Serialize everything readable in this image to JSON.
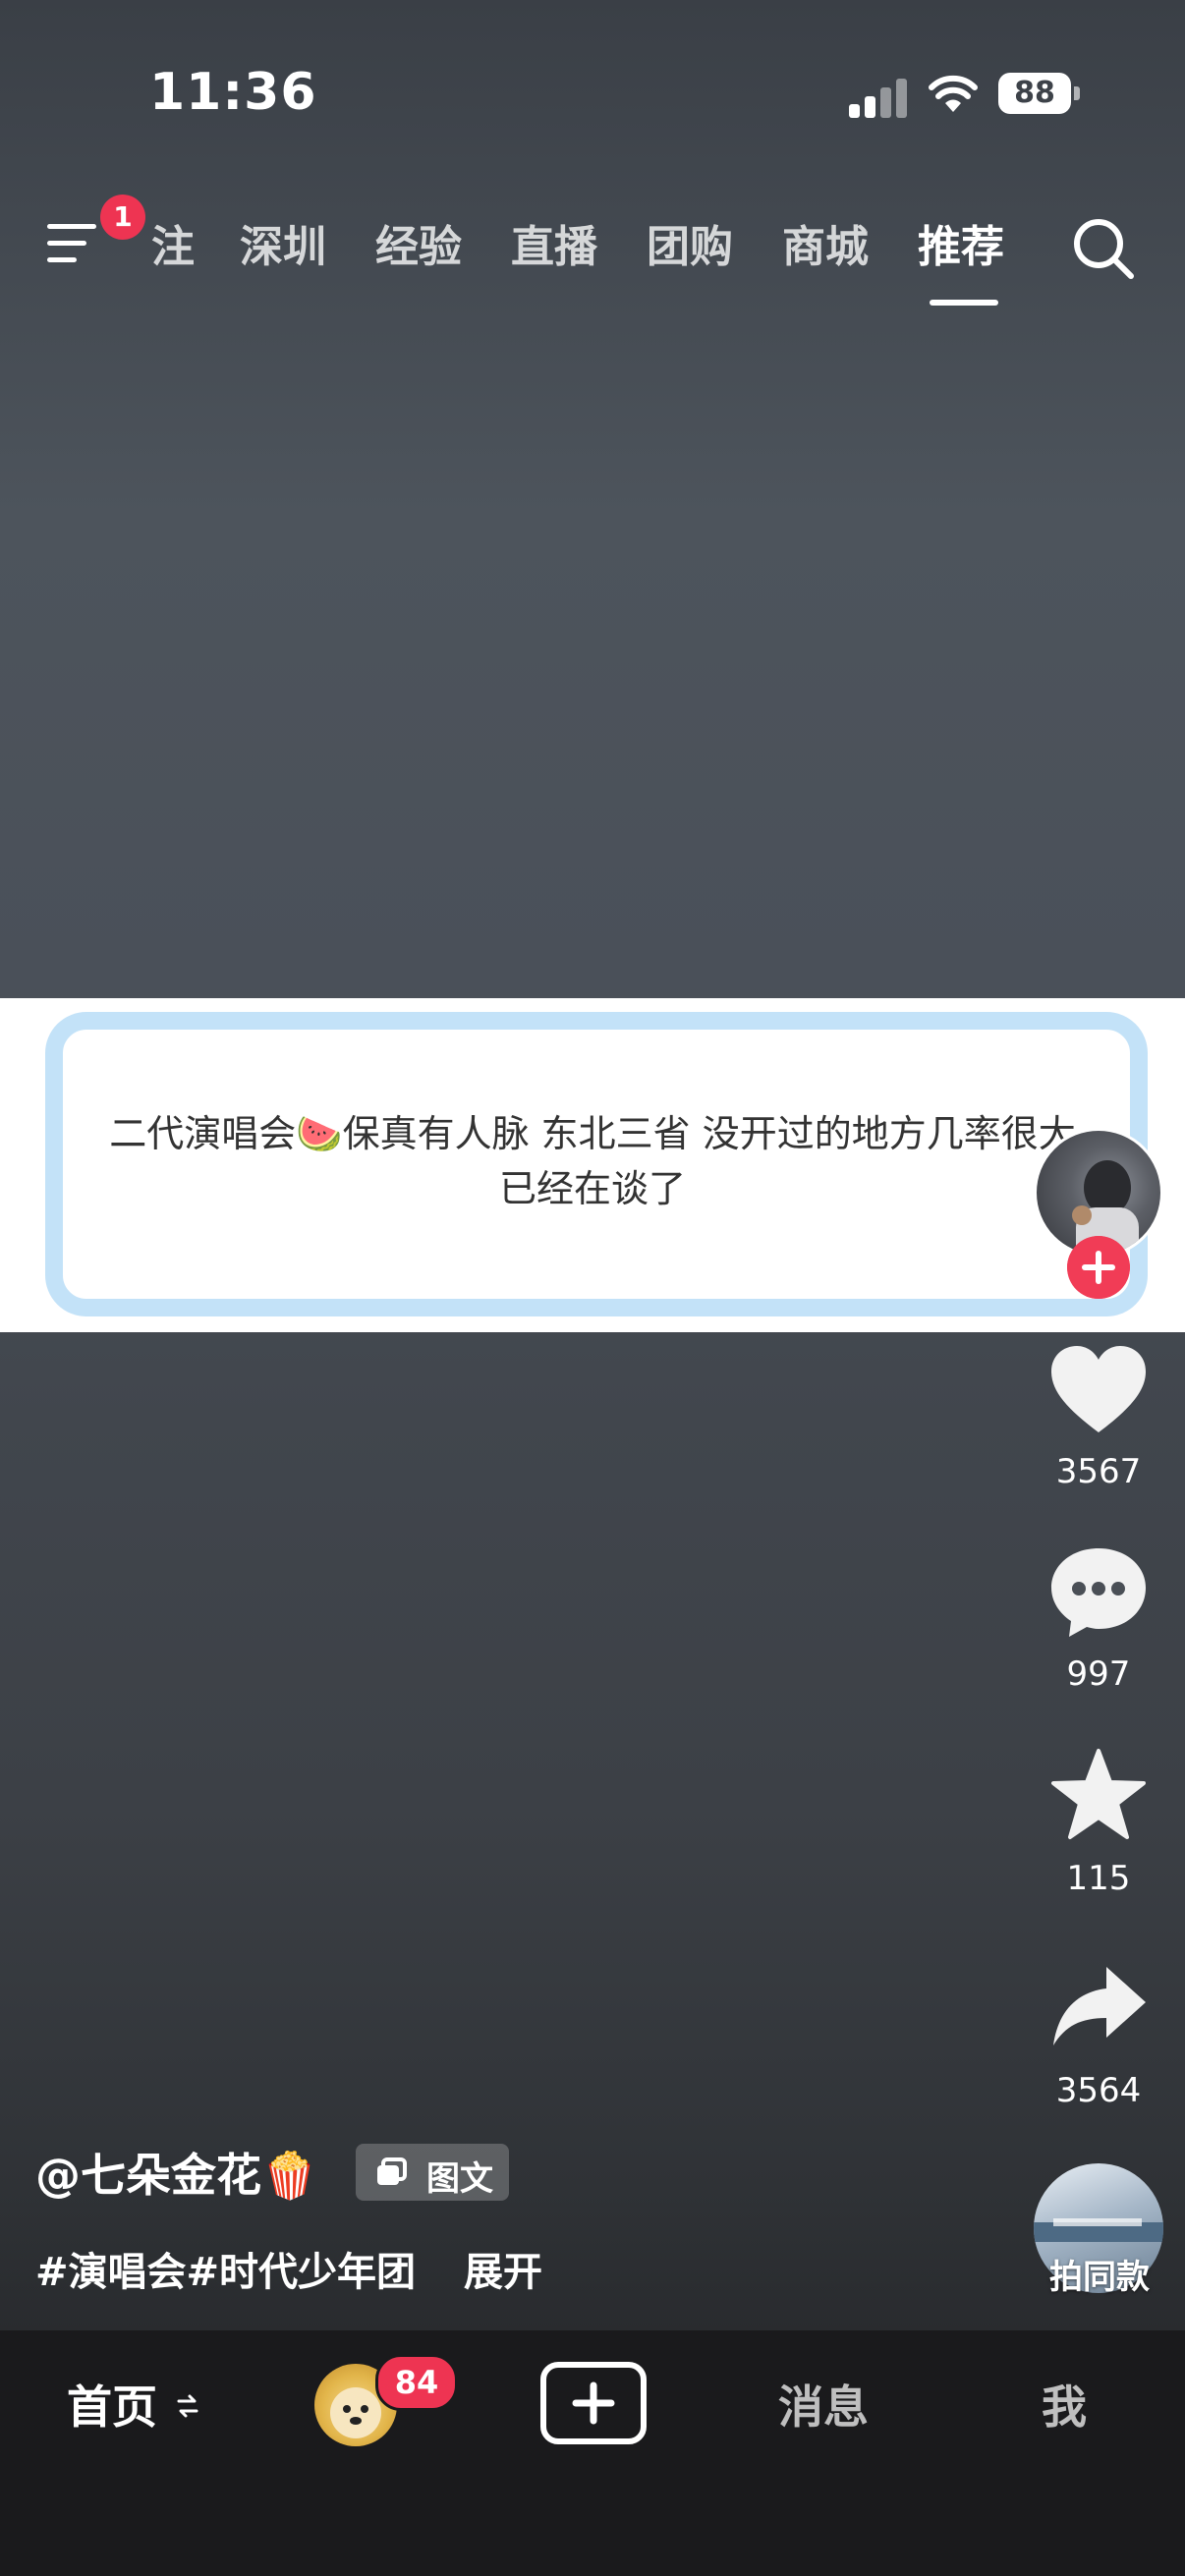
{
  "status_bar": {
    "time": "11:36",
    "battery": "88"
  },
  "top_nav": {
    "menu_badge": "1",
    "tabs": [
      {
        "label": "注"
      },
      {
        "label": "深圳"
      },
      {
        "label": "经验"
      },
      {
        "label": "直播"
      },
      {
        "label": "团购"
      },
      {
        "label": "商城"
      },
      {
        "label": "推荐"
      }
    ],
    "active_tab": "推荐"
  },
  "post": {
    "text": "二代演唱会🍉保真有人脉 东北三省 没开过的地方几率很大 已经在谈了",
    "author": "@七朵金花🍿",
    "type_badge": "图文",
    "hashtags": "#演唱会#时代少年团",
    "expand_label": "展开"
  },
  "actions": {
    "likes": "3567",
    "comments": "997",
    "favorites": "115",
    "shares": "3564",
    "same_style_label": "拍同款"
  },
  "bottom_nav": {
    "home": "首页",
    "friends_badge": "84",
    "messages": "消息",
    "me": "我"
  },
  "colors": {
    "badge": "#ee3452",
    "follow": "#f13c56",
    "card_border": "#c3e2f8",
    "bottom_bar": "#1a1a1c"
  }
}
